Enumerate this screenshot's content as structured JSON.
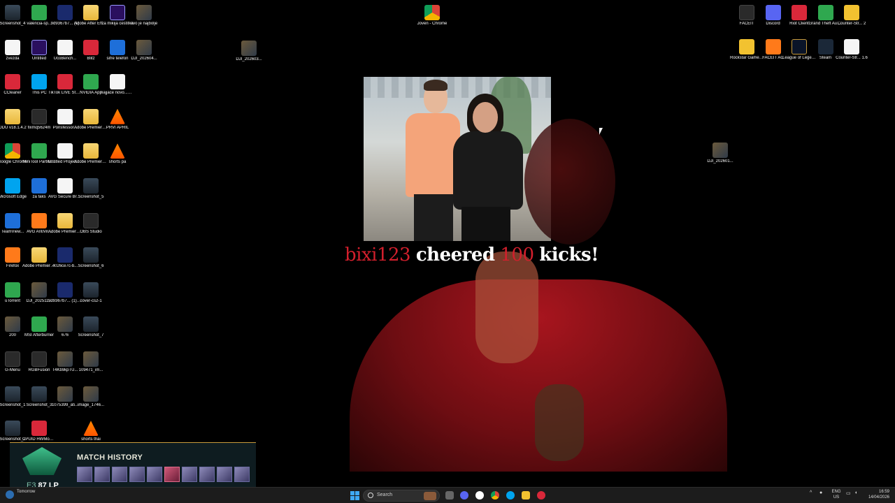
{
  "desktop": {
    "icons_col1": [
      {
        "label": "Screenshot_4",
        "icon": "screenshot-icon",
        "color": "c-shot"
      },
      {
        "label": "zvezda",
        "icon": "recycle-bin-icon",
        "color": "c-white"
      },
      {
        "label": "CCleaner",
        "icon": "ccleaner-icon",
        "color": "c-red"
      },
      {
        "label": "DDU v18.1.4.2",
        "icon": "folder-icon",
        "color": "c-folder"
      },
      {
        "label": "Google Chrome",
        "icon": "chrome-icon",
        "color": "c-chrome"
      },
      {
        "label": "Microsoft Edge",
        "icon": "edge-icon",
        "color": "c-teal"
      },
      {
        "label": "TeamView...",
        "icon": "teamviewer-icon",
        "color": "c-blue"
      },
      {
        "label": "Firefox",
        "icon": "firefox-icon",
        "color": "c-orange"
      },
      {
        "label": "uTorrent",
        "icon": "utorrent-icon",
        "color": "c-green"
      },
      {
        "label": "200",
        "icon": "photo-icon",
        "color": "c-photo"
      },
      {
        "label": "G-Menu",
        "icon": "gmenu-icon",
        "color": "c-dark"
      },
      {
        "label": "Screenshot_1",
        "icon": "screenshot-icon",
        "color": "c-shot"
      },
      {
        "label": "Screenshot_2",
        "icon": "screenshot-icon",
        "color": "c-shot"
      }
    ],
    "icons_col2": [
      {
        "label": "valencia-sp...",
        "icon": "image-icon",
        "color": "c-green"
      },
      {
        "label": "Untitled",
        "icon": "premiere-icon",
        "color": "c-pr"
      },
      {
        "label": "This PC",
        "icon": "monitor-icon",
        "color": "c-teal"
      },
      {
        "label": "fixmq5624m",
        "icon": "app-icon",
        "color": "c-dark"
      },
      {
        "label": "MiniTool Partitio...",
        "icon": "minitool-icon",
        "color": "c-green"
      },
      {
        "label": "za faks",
        "icon": "word-icon",
        "color": "c-blue"
      },
      {
        "label": "AVG AntiVir...",
        "icon": "avg-icon",
        "color": "c-orange"
      },
      {
        "label": "Adobe Premiere P...",
        "icon": "folder-icon",
        "color": "c-folder"
      },
      {
        "label": "DJI_202511...",
        "icon": "video-icon",
        "color": "c-photo"
      },
      {
        "label": "MSI Afterburner",
        "icon": "msi-icon",
        "color": "c-green"
      },
      {
        "label": "RGBFusion",
        "icon": "rgb-icon",
        "color": "c-dark"
      },
      {
        "label": "Screenshot_3",
        "icon": "screenshot-icon",
        "color": "c-shot"
      },
      {
        "label": "CPUID HWMonitor",
        "icon": "cpuid-icon",
        "color": "c-red"
      }
    ],
    "icons_col3": [
      {
        "label": "9d9367b7... (1)",
        "icon": "image-icon",
        "color": "c-navy"
      },
      {
        "label": "UcoBench...",
        "icon": "benchmark-icon",
        "color": "c-white"
      },
      {
        "label": "TikTok LIVE Studio",
        "icon": "tiktok-icon",
        "color": "c-red"
      },
      {
        "label": "Ponsfessor...",
        "icon": "app-icon",
        "color": "c-white"
      },
      {
        "label": "Untitled Project.aep",
        "icon": "document-icon",
        "color": "c-white"
      },
      {
        "label": "AVG Secure Browser",
        "icon": "avg-browser-icon",
        "color": "c-white"
      },
      {
        "label": "Adobe Premiere P...",
        "icon": "folder-icon",
        "color": "c-folder"
      },
      {
        "label": "4026ce7c-b...",
        "icon": "image-icon",
        "color": "c-navy"
      },
      {
        "label": "9d9367b7... (1) (1)",
        "icon": "image-icon",
        "color": "c-navy"
      },
      {
        "label": "676",
        "icon": "photo-icon",
        "color": "c-photo"
      },
      {
        "label": "T4Kb9kpTU...",
        "icon": "photo-icon",
        "color": "c-photo"
      },
      {
        "label": "1075399_ati...",
        "icon": "photo-icon",
        "color": "c-photo"
      }
    ],
    "icons_col4": [
      {
        "label": "Adobe After Effects Au...",
        "icon": "folder-icon",
        "color": "c-folder"
      },
      {
        "label": "Blitz",
        "icon": "blitz-icon",
        "color": "c-red"
      },
      {
        "label": "NVIDIA App",
        "icon": "nvidia-icon",
        "color": "c-green"
      },
      {
        "label": "Adobe Premiere P...",
        "icon": "folder-icon",
        "color": "c-folder"
      },
      {
        "label": "Adobe Premiere P...",
        "icon": "folder-icon",
        "color": "c-folder"
      },
      {
        "label": "Screenshot_5",
        "icon": "screenshot-icon",
        "color": "c-shot"
      },
      {
        "label": "OBS Studio",
        "icon": "obs-icon",
        "color": "c-dark"
      },
      {
        "label": "Screenshot_6",
        "icon": "screenshot-icon",
        "color": "c-shot"
      },
      {
        "label": "cover-cs2-1",
        "icon": "image-icon",
        "color": "c-shot"
      },
      {
        "label": "Screenshot_7",
        "icon": "screenshot-icon",
        "color": "c-shot"
      },
      {
        "label": "109471_im...",
        "icon": "photo-icon",
        "color": "c-photo"
      },
      {
        "label": "image_1746...",
        "icon": "photo-icon",
        "color": "c-photo"
      },
      {
        "label": "shorts thai",
        "icon": "vlc-icon",
        "color": "c-vlc"
      }
    ],
    "icons_col5": [
      {
        "label": "za mikija cestitka",
        "icon": "premiere-icon",
        "color": "c-pr"
      },
      {
        "label": "sifre telefon",
        "icon": "word-icon",
        "color": "c-blue"
      },
      {
        "label": "najjace novo...aep",
        "icon": "document-icon",
        "color": "c-white"
      },
      {
        "label": "PRVI APRIL",
        "icon": "vlc-icon",
        "color": "c-vlc"
      },
      {
        "label": "shorts pa",
        "icon": "vlc-icon",
        "color": "c-vlc"
      }
    ],
    "icons_col6": [
      {
        "label": "ovo je najbolje",
        "icon": "video-icon",
        "color": "c-photo"
      },
      {
        "label": "DJI_202604...",
        "icon": "video-icon",
        "color": "c-photo"
      }
    ],
    "icon_dji_mid": {
      "label": "DJI_202603...",
      "icon": "video-icon",
      "color": "c-photo"
    },
    "icon_joven": {
      "label": "Joven - Chrome",
      "icon": "chrome-icon",
      "color": "c-chrome"
    },
    "icon_dji_right": {
      "label": "DJI_202601...",
      "icon": "video-icon",
      "color": "c-photo"
    },
    "icons_top_right_row1": [
      {
        "label": "FACEIT",
        "icon": "faceit-icon",
        "color": "c-dark"
      },
      {
        "label": "Discord",
        "icon": "discord-icon",
        "color": "c-purple"
      },
      {
        "label": "Riot Client",
        "icon": "riot-icon",
        "color": "c-red"
      },
      {
        "label": "Grand Theft Auto V Lo...",
        "icon": "gta-icon",
        "color": "c-green"
      },
      {
        "label": "Counter-Str... 2",
        "icon": "cs2-icon",
        "color": "c-yellow"
      }
    ],
    "icons_top_right_row2": [
      {
        "label": "Rockstar Games...",
        "icon": "rockstar-icon",
        "color": "c-yellow"
      },
      {
        "label": "FACEIT AC",
        "icon": "faceit-ac-icon",
        "color": "c-orange"
      },
      {
        "label": "League of Legends",
        "icon": "lol-icon",
        "color": "c-lol"
      },
      {
        "label": "Steam",
        "icon": "steam-icon",
        "color": "c-steam"
      },
      {
        "label": "Counter-Str... 1.6",
        "icon": "cs16-icon",
        "color": "c-white"
      }
    ]
  },
  "alert": {
    "user": "bixi123",
    "verb": "cheered",
    "amount": "100",
    "unit": "kicks!"
  },
  "match_history": {
    "title": "MATCH HISTORY",
    "tier": "E3",
    "lp": "87 LP",
    "games": [
      "loss",
      "loss",
      "loss",
      "loss",
      "loss",
      "win",
      "loss",
      "loss",
      "loss",
      "loss"
    ]
  },
  "taskbar": {
    "weather_line1": "",
    "weather_line2": "Tomorrow",
    "search_placeholder": "Search",
    "lang_line1": "ENG",
    "lang_line2": "US",
    "time": "16:59",
    "date": "14/04/2026"
  }
}
